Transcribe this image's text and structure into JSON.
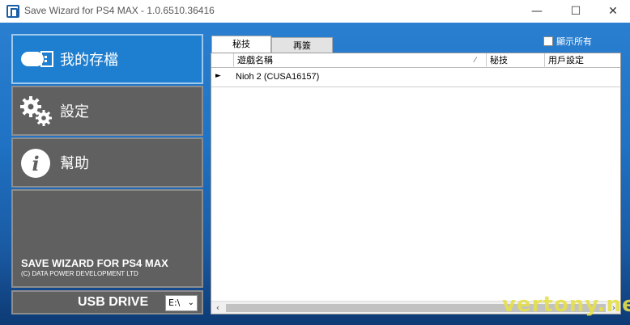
{
  "window": {
    "title": "Save Wizard for PS4 MAX - 1.0.6510.36416",
    "minimize": "—",
    "maximize": "☐",
    "close": "✕"
  },
  "sidebar": {
    "my_saves": "我的存檔",
    "settings": "設定",
    "help": "幫助",
    "brand_title": "SAVE WIZARD FOR PS4 MAX",
    "brand_sub": "(C) DATA POWER DEVELOPMENT LTD",
    "usb_label": "USB DRIVE",
    "usb_value": "E:\\"
  },
  "tabs": {
    "cheats": "秘技",
    "resign": "再簽"
  },
  "show_all_label": "顯示所有",
  "grid": {
    "columns": [
      "遊戲名稱",
      "秘技",
      "用戶設定"
    ],
    "rows": [
      {
        "name": "Nioh 2 (CUSA16157)"
      }
    ]
  },
  "watermark": "vertony.net",
  "colors": {
    "background_top": "#2a7fd0",
    "background_bottom": "#0d3a74",
    "active_button": "#1e7fd0",
    "inactive_button": "#606060",
    "watermark": "#e6e04a"
  }
}
